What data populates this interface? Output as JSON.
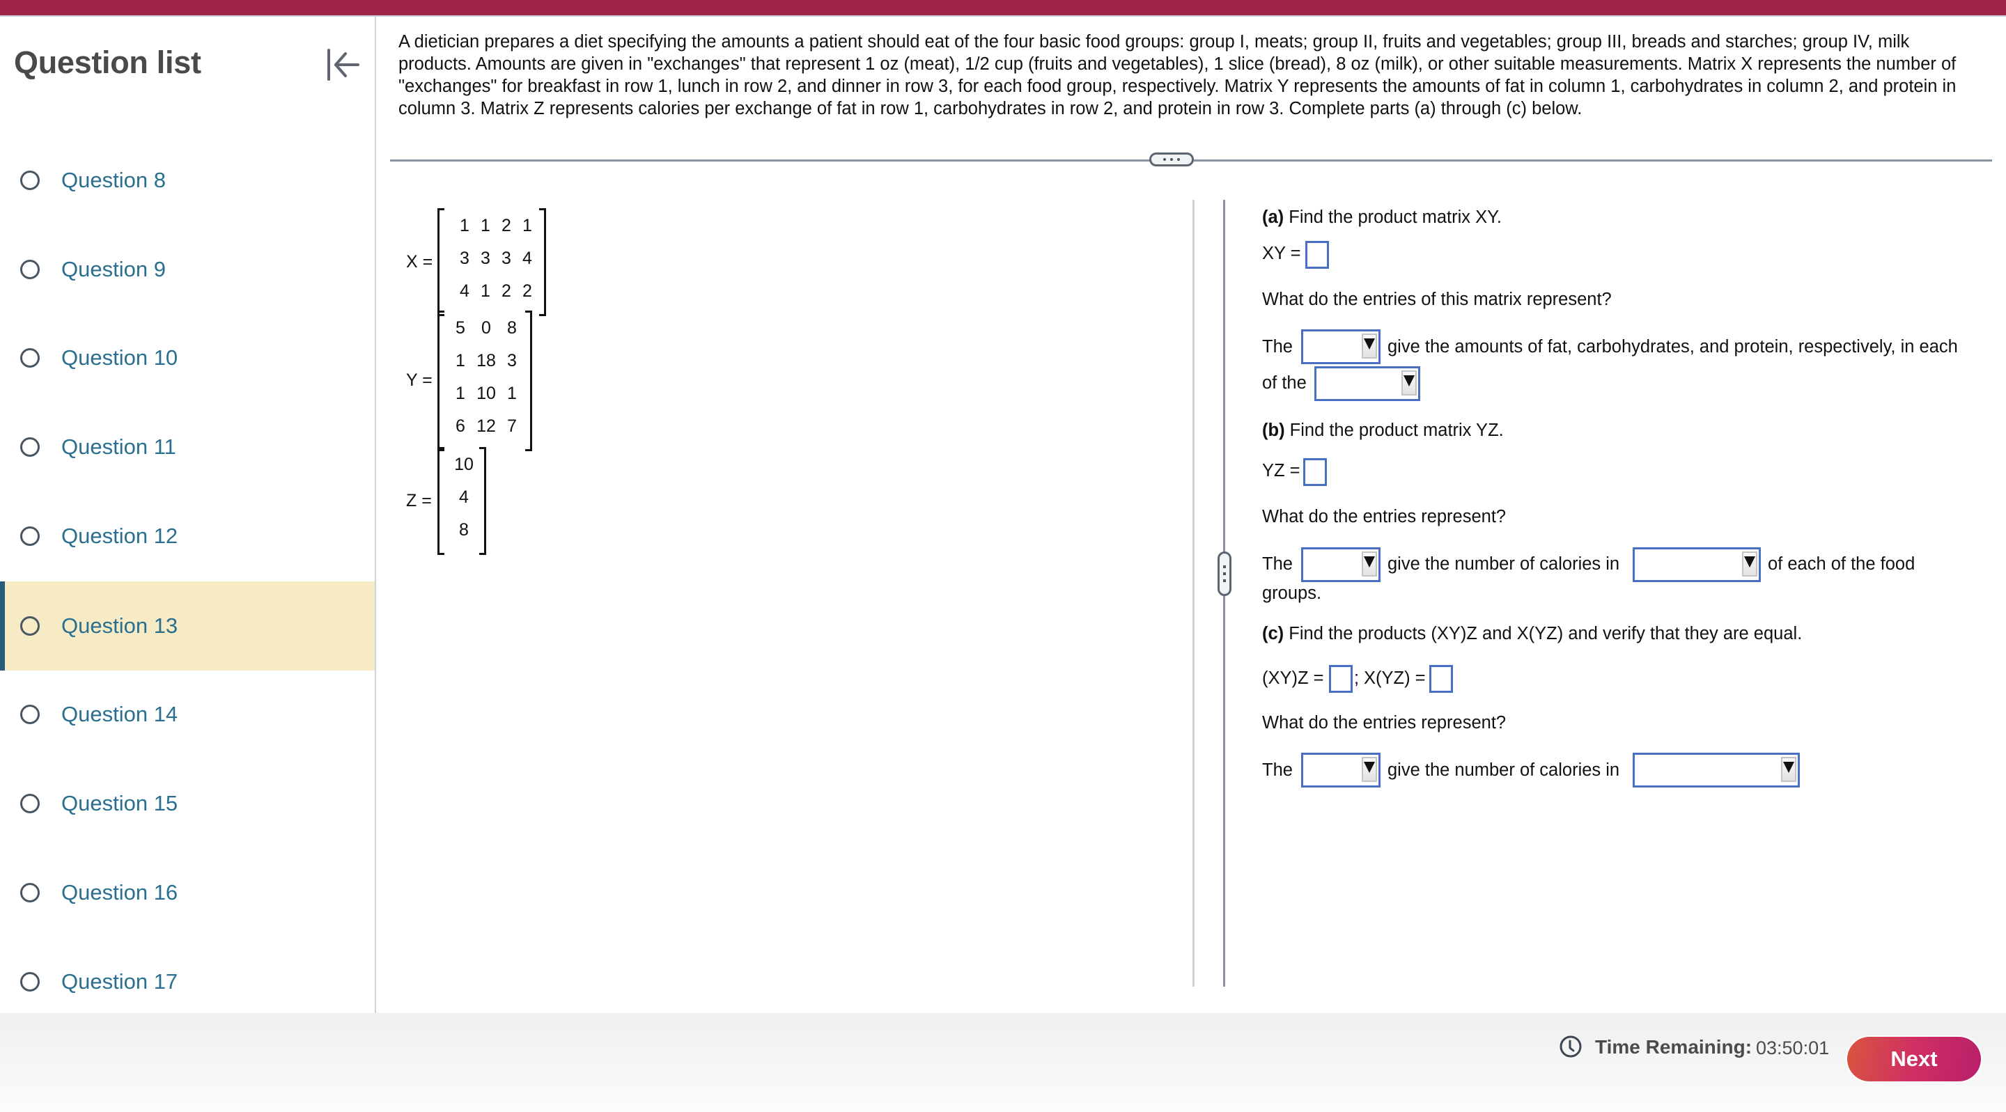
{
  "sidebar": {
    "title": "Question list",
    "collapse_icon": "collapse-left-icon",
    "items": [
      {
        "label": "Question 8",
        "active": false
      },
      {
        "label": "Question 9",
        "active": false
      },
      {
        "label": "Question 10",
        "active": false
      },
      {
        "label": "Question 11",
        "active": false
      },
      {
        "label": "Question 12",
        "active": false
      },
      {
        "label": "Question 13",
        "active": true
      },
      {
        "label": "Question 14",
        "active": false
      },
      {
        "label": "Question 15",
        "active": false
      },
      {
        "label": "Question 16",
        "active": false
      },
      {
        "label": "Question 17",
        "active": false
      }
    ]
  },
  "question": {
    "stem": "A dietician prepares a diet specifying the amounts a patient should eat of the four basic food groups: group I, meats; group II, fruits and vegetables; group III, breads and starches; group IV, milk products. Amounts are given in \"exchanges\" that represent 1 oz (meat), 1/2 cup (fruits and vegetables), 1 slice (bread), 8 oz (milk), or other suitable measurements. Matrix X represents the number of \"exchanges\" for breakfast in row 1, lunch in row 2, and dinner in row 3, for each food group, respectively. Matrix Y represents the amounts of fat in column 1, carbohydrates in column 2, and protein in column 3. Matrix Z represents calories per exchange of fat in row 1, carbohydrates in row 2, and protein in row 3. Complete parts (a) through (c) below.",
    "matrices": {
      "X": {
        "label": "X =",
        "rows": [
          [
            "1",
            "1",
            "2",
            "1"
          ],
          [
            "3",
            "3",
            "3",
            "4"
          ],
          [
            "4",
            "1",
            "2",
            "2"
          ]
        ]
      },
      "Y": {
        "label": "Y =",
        "rows": [
          [
            "5",
            "0",
            "8"
          ],
          [
            "1",
            "18",
            "3"
          ],
          [
            "1",
            "10",
            "1"
          ],
          [
            "6",
            "12",
            "7"
          ]
        ]
      },
      "Z": {
        "label": "Z =",
        "rows": [
          [
            "10"
          ],
          [
            "4"
          ],
          [
            "8"
          ]
        ]
      }
    }
  },
  "parts": {
    "a": {
      "tag": "(a)",
      "prompt": "Find the product matrix XY.",
      "answer_label": "XY =",
      "answer_value": "",
      "represent_q": "What do the entries of this matrix represent?",
      "s1_the": "The",
      "s1_after_dd1": "give the amounts of fat, carbohydrates, and protein, respectively, in each",
      "s1_of_the": "of the",
      "dd1_value": "",
      "dd2_value": ""
    },
    "b": {
      "tag": "(b)",
      "prompt": "Find the product matrix YZ.",
      "answer_label": "YZ =",
      "answer_value": "",
      "represent_q": "What do the entries represent?",
      "s1_the": "The",
      "s1_after_dd1": "give the number of calories in",
      "s1_after_dd2": "of each of the food",
      "s1_end": "groups.",
      "dd1_value": "",
      "dd2_value": ""
    },
    "c": {
      "tag": "(c)",
      "prompt": "Find the products (XY)Z and X(YZ) and verify that they are equal.",
      "answer1_label": "(XY)Z =",
      "separator": ";",
      "answer2_label": "X(YZ) =",
      "answer1_value": "",
      "answer2_value": "",
      "represent_q": "What do the entries represent?",
      "s1_the": "The",
      "s1_after_dd1": "give the number of calories in",
      "dd1_value": "",
      "dd2_value": ""
    }
  },
  "footer": {
    "timer_icon": "clock-icon",
    "timer_label": "Time Remaining:",
    "timer_value": "03:50:01",
    "next_label": "Next"
  },
  "colors": {
    "top_bar": "#a0244a",
    "link": "#2a6f8f",
    "active_bg": "#f7ebc5",
    "active_bar": "#275c7a",
    "input_border": "#4a6fc7"
  }
}
